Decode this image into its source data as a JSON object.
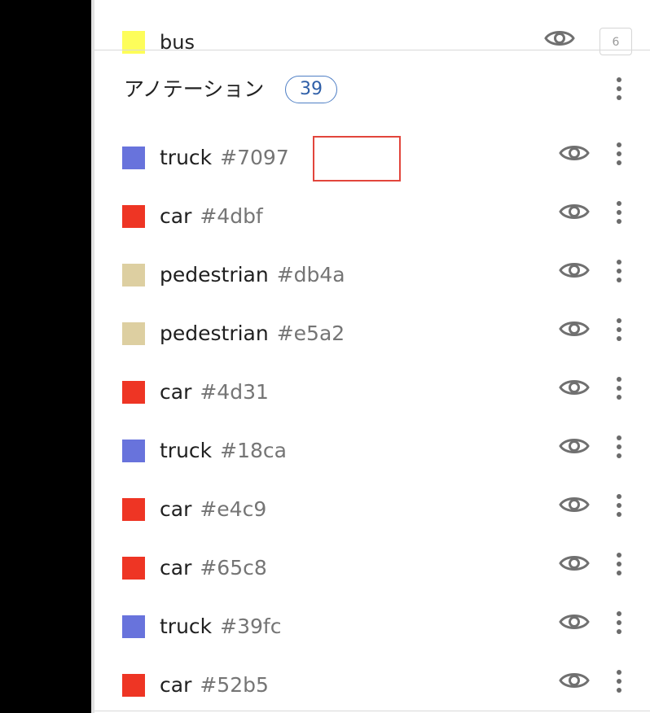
{
  "top_item": {
    "label": "bus",
    "color": "#fdfd5a",
    "count": "6"
  },
  "header": {
    "title": "アノテーション",
    "count": "39"
  },
  "annotations": [
    {
      "label": "truck",
      "id": "#7097",
      "color": "#6873dc"
    },
    {
      "label": "car",
      "id": "#4dbf",
      "color": "#ee3524"
    },
    {
      "label": "pedestrian",
      "id": "#db4a",
      "color": "#ddcfa1"
    },
    {
      "label": "pedestrian",
      "id": "#e5a2",
      "color": "#ddcfa1"
    },
    {
      "label": "car",
      "id": "#4d31",
      "color": "#ee3524"
    },
    {
      "label": "truck",
      "id": "#18ca",
      "color": "#6873dc"
    },
    {
      "label": "car",
      "id": "#e4c9",
      "color": "#ee3524"
    },
    {
      "label": "car",
      "id": "#65c8",
      "color": "#ee3524"
    },
    {
      "label": "truck",
      "id": "#39fc",
      "color": "#6873dc"
    },
    {
      "label": "car",
      "id": "#52b5",
      "color": "#ee3524"
    }
  ],
  "icons": {
    "visibility": "eye-icon",
    "more": "more-vert-icon"
  },
  "highlight_target": "#7097"
}
